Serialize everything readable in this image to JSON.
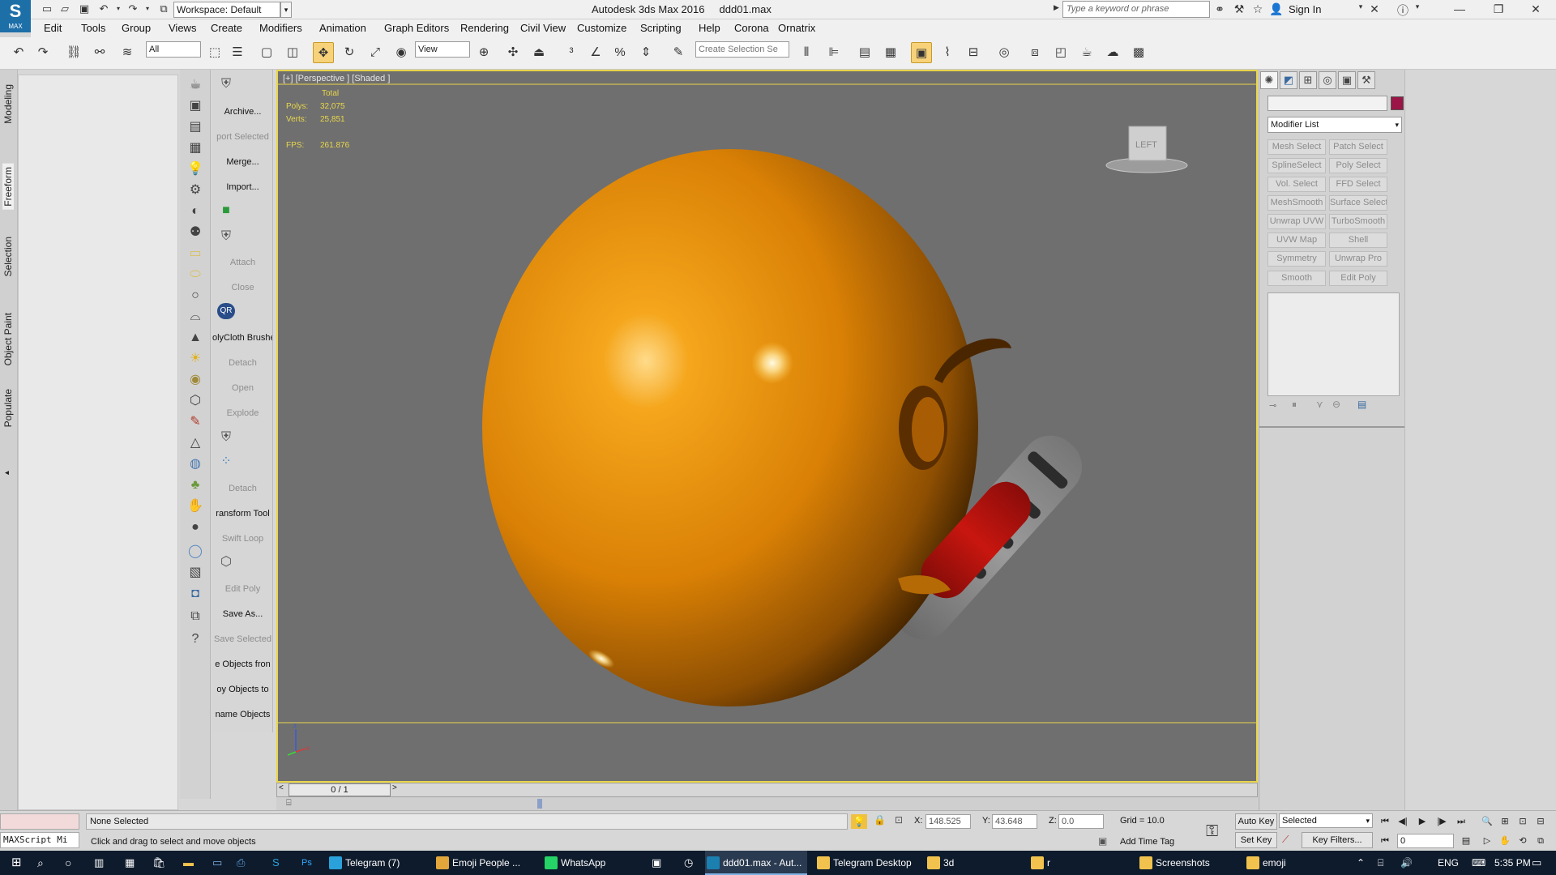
{
  "app": {
    "logo_label": "MAX",
    "workspace": "Workspace: Default",
    "title": "Autodesk 3ds Max 2016",
    "file": "ddd01.max",
    "search_placeholder": "Type a keyword or phrase",
    "sign_in": "Sign In"
  },
  "menu": [
    "Edit",
    "Tools",
    "Group",
    "Views",
    "Create",
    "Modifiers",
    "Animation",
    "Graph Editors",
    "Rendering",
    "Civil View",
    "Customize",
    "Scripting",
    "Help",
    "Corona",
    "Ornatrix"
  ],
  "toolbar": {
    "selection_filter": "All",
    "ref_coord": "View",
    "named_selection_placeholder": "Create Selection Se"
  },
  "ribbon_tabs": [
    "Modeling",
    "Freeform",
    "Selection",
    "Object Paint",
    "Populate"
  ],
  "script_panel": {
    "labels": [
      {
        "text": "Archive...",
        "dim": false
      },
      {
        "text": "port Selected",
        "dim": true
      },
      {
        "text": "Merge...",
        "dim": false
      },
      {
        "text": "Import...",
        "dim": false
      },
      {
        "text": "",
        "dim": false
      },
      {
        "text": "",
        "dim": false
      },
      {
        "text": "Attach",
        "dim": true
      },
      {
        "text": "Close",
        "dim": true
      },
      {
        "text": "",
        "dim": false
      },
      {
        "text": "olyCloth Brushe",
        "dim": false
      },
      {
        "text": "Detach",
        "dim": true
      },
      {
        "text": "Open",
        "dim": true
      },
      {
        "text": "Explode",
        "dim": true
      },
      {
        "text": "",
        "dim": false
      },
      {
        "text": "",
        "dim": false
      },
      {
        "text": "Detach",
        "dim": true
      },
      {
        "text": "ransform Tool",
        "dim": false
      },
      {
        "text": "Swift Loop",
        "dim": true
      },
      {
        "text": "",
        "dim": false
      },
      {
        "text": "Edit Poly",
        "dim": true
      },
      {
        "text": "Save As...",
        "dim": false
      },
      {
        "text": "Save Selected",
        "dim": true
      },
      {
        "text": "e Objects fron",
        "dim": false
      },
      {
        "text": "oy Objects to",
        "dim": false
      },
      {
        "text": "name Objects",
        "dim": false
      }
    ]
  },
  "viewport": {
    "label": "[+] [Perspective ] [Shaded ]",
    "stats_header": "Total",
    "polys_label": "Polys:",
    "polys": "32,075",
    "verts_label": "Verts:",
    "verts": "25,851",
    "fps_label": "FPS:",
    "fps": "261.876",
    "viewcube_label": "LEFT",
    "sphere_color": "#e08a06",
    "object_red": "#b3120f",
    "object_grey": "#8c8c8c"
  },
  "time_slider": {
    "frame": "0 / 1"
  },
  "command_panel": {
    "modifier_list": "Modifier List",
    "object_color": "#9b1546",
    "buttons": [
      [
        "Mesh Select",
        "Patch Select"
      ],
      [
        "SplineSelect",
        "Poly Select"
      ],
      [
        "Vol. Select",
        "FFD Select"
      ],
      [
        "MeshSmooth",
        "Surface Select"
      ],
      [
        "Unwrap UVW",
        "TurboSmooth"
      ],
      [
        "UVW Map",
        "Shell"
      ],
      [
        "Symmetry",
        "Unwrap Pro"
      ],
      [
        "Smooth",
        "Edit Poly"
      ]
    ]
  },
  "status": {
    "maxscript": "MAXScript Mi",
    "selection": "None Selected",
    "prompt": "Click and drag to select and move objects",
    "x_label": "X:",
    "x": "148.525",
    "y_label": "Y:",
    "y": "43.648",
    "z_label": "Z:",
    "z": "0.0",
    "grid": "Grid = 10.0",
    "add_time_tag": "Add Time Tag",
    "auto_key": "Auto Key",
    "set_key": "Set Key",
    "selected": "Selected",
    "key_filters": "Key Filters...",
    "frame_field": "0"
  },
  "taskbar": {
    "items": [
      {
        "label": "Telegram (7)",
        "color": "#2aa1da"
      },
      {
        "label": "Emoji People ...",
        "color": "#e2a63b"
      },
      {
        "label": "WhatsApp",
        "color": "#25d366"
      },
      {
        "label": "ddd01.max - Aut...",
        "color": "#1b7fb0"
      },
      {
        "label": "Telegram Desktop",
        "color": "#f1c34e"
      },
      {
        "label": "3d",
        "color": "#f1c34e"
      },
      {
        "label": "r",
        "color": "#f1c34e"
      },
      {
        "label": "Screenshots",
        "color": "#f1c34e"
      },
      {
        "label": "emoji",
        "color": "#f1c34e"
      }
    ],
    "lang": "ENG",
    "time": "5:35 PM"
  }
}
